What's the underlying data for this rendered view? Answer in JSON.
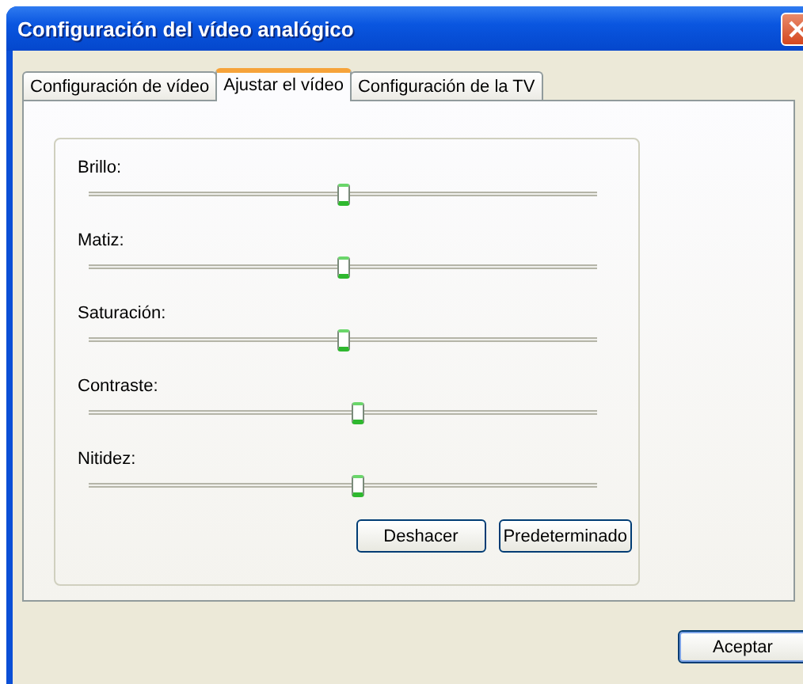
{
  "window": {
    "title": "Configuración del vídeo analógico"
  },
  "tabs": [
    {
      "label": "Configuración de vídeo",
      "selected": false
    },
    {
      "label": "Ajustar el vídeo",
      "selected": true
    },
    {
      "label": "Configuración de la TV",
      "selected": false
    }
  ],
  "sliders": [
    {
      "label": "Brillo:",
      "level": 0.5
    },
    {
      "label": "Matiz:",
      "level": 0.5
    },
    {
      "label": "Saturación:",
      "level": 0.5
    },
    {
      "label": "Contraste:",
      "level": 0.53
    },
    {
      "label": "Nitidez:",
      "level": 0.53
    }
  ],
  "group_buttons": [
    "Deshacer",
    "Predeterminado"
  ],
  "buttons": [
    "Aceptar"
  ]
}
